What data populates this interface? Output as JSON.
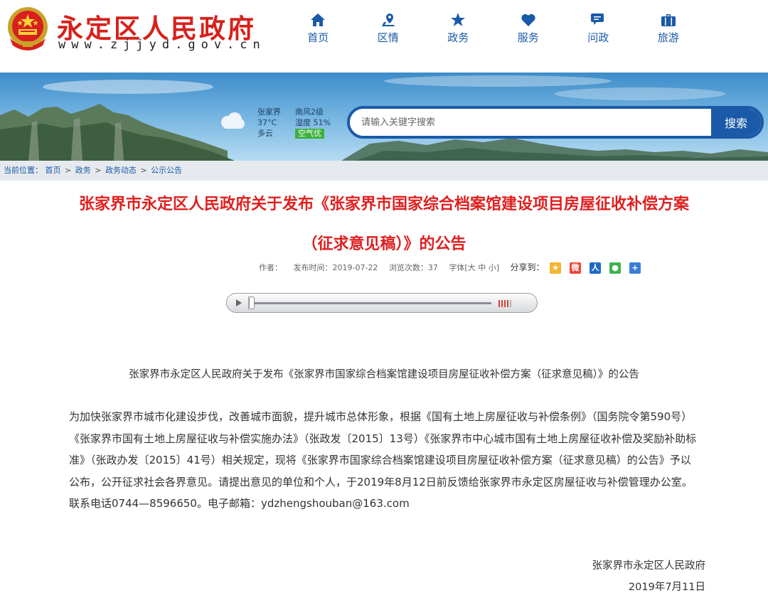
{
  "header": {
    "site_title": "永定区人民政府",
    "site_url": "www.zjjyd.gov.cn",
    "nav": [
      {
        "label": "首页",
        "icon": "home-icon"
      },
      {
        "label": "区情",
        "icon": "map-pin-icon"
      },
      {
        "label": "政务",
        "icon": "star-icon"
      },
      {
        "label": "服务",
        "icon": "heart-icon"
      },
      {
        "label": "问政",
        "icon": "chat-icon"
      },
      {
        "label": "旅游",
        "icon": "suitcase-icon"
      }
    ]
  },
  "weather": {
    "city": "张家界",
    "temperature": "37°C",
    "condition": "多云",
    "wind": "南风2级",
    "humidity": "湿度 51%",
    "air_quality": "空气优"
  },
  "search": {
    "placeholder": "请输入关键字搜索",
    "button_label": "搜索"
  },
  "breadcrumb": {
    "prefix": "当前位置：",
    "items": [
      "首页",
      "政务",
      "政务动态",
      "公示公告"
    ],
    "separator": ">"
  },
  "article": {
    "title_line1": "张家界市永定区人民政府关于发布《张家界市国家综合档案馆建设项目房屋征收补偿方案",
    "title_line2": "（征求意见稿）》的公告",
    "meta": {
      "author": "作者：",
      "publish_time": "发布时间：2019-07-22",
      "views": "浏览次数：37",
      "font_size": "字体[大 中 小]",
      "share": "分享到："
    },
    "share_icons": [
      "qzone-icon",
      "weibo-icon",
      "renren-icon",
      "wechat-icon",
      "more-share-icon"
    ],
    "subtitle": "张家界市永定区人民政府关于发布《张家界市国家综合档案馆建设项目房屋征收补偿方案（征求意见稿）》的公告",
    "body": "为加快张家界市城市化建设步伐，改善城市面貌，提升城市总体形象，根据《国有土地上房屋征收与补偿条例》（国务院令第590号）《张家界市国有土地上房屋征收与补偿实施办法》（张政发〔2015〕13号）《张家界市中心城市国有土地上房屋征收补偿及奖励补助标准》（张政办发〔2015〕41号）相关规定，现将《张家界市国家综合档案馆建设项目房屋征收补偿方案（征求意见稿）的公告》予以公布，公开征求社会各界意见。请提出意见的单位和个人，于2019年8月12日前反馈给张家界市永定区房屋征收与补偿管理办公室。联系电话0744—8596650。电子邮箱：ydzhengshouban@163.com",
    "signature": "张家界市永定区人民政府",
    "date": "2019年7月11日"
  },
  "colors": {
    "brand_red": "#d7201a",
    "title_red": "#e01f1f",
    "nav_blue": "#1a5aa8",
    "aq_green": "#3bb13b"
  }
}
